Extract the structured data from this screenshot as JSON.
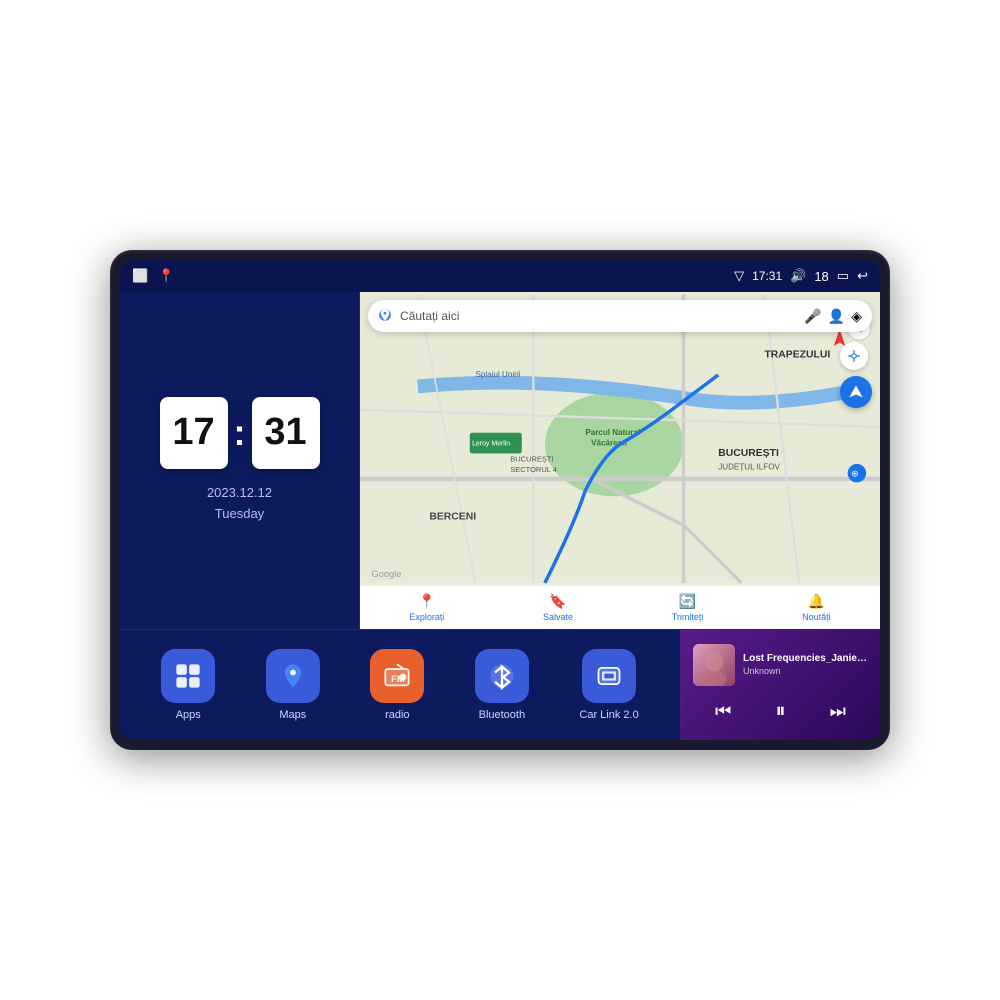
{
  "device": {
    "status_bar": {
      "left_icons": [
        "home-icon",
        "maps-pin-icon"
      ],
      "signal_icon": "▽",
      "time": "17:31",
      "volume_icon": "🔊",
      "battery_level": "18",
      "battery_icon": "🔋",
      "back_icon": "↩"
    },
    "clock": {
      "hour": "17",
      "minute": "31",
      "date": "2023.12.12",
      "day": "Tuesday"
    },
    "map": {
      "search_placeholder": "Căutați aici",
      "labels": {
        "trapezului": "TRAPEZULUI",
        "bucuresti": "BUCUREȘTI",
        "judet_ilfov": "JUDEȚUL ILFOV",
        "berceni": "BERCENI",
        "splaiul_unirii": "Splaiul Unirii",
        "parc": "Parcul Natural Văcărești",
        "leroy": "Leroy Merlin",
        "bucuresti_sector": "BUCUREȘTI\nSECTORUL 4",
        "google": "Google"
      },
      "nav_items": [
        {
          "label": "Explorați",
          "icon": "📍"
        },
        {
          "label": "Salvate",
          "icon": "🔖"
        },
        {
          "label": "Trimiteți",
          "icon": "🔄"
        },
        {
          "label": "Noutăți",
          "icon": "🔔"
        }
      ]
    },
    "apps": [
      {
        "id": "apps",
        "label": "Apps",
        "icon": "⊞",
        "color": "#3a5bd9"
      },
      {
        "id": "maps",
        "label": "Maps",
        "icon": "📍",
        "color": "#3a5bd9"
      },
      {
        "id": "radio",
        "label": "radio",
        "icon": "📻",
        "color": "#e8602c"
      },
      {
        "id": "bluetooth",
        "label": "Bluetooth",
        "icon": "🔷",
        "color": "#3a5bd9"
      },
      {
        "id": "carlink",
        "label": "Car Link 2.0",
        "icon": "📱",
        "color": "#3a5bd9"
      }
    ],
    "music": {
      "title": "Lost Frequencies_Janieck Devy-...",
      "artist": "Unknown",
      "controls": {
        "prev": "⏮",
        "play": "⏸",
        "next": "⏭"
      }
    }
  }
}
